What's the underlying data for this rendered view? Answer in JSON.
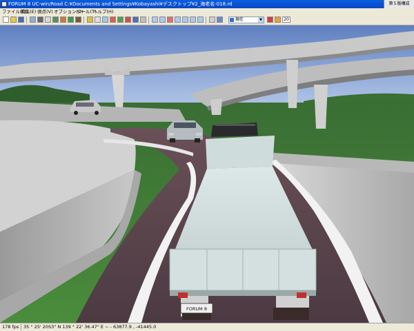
{
  "window": {
    "title": "FORUM 8   UC-win/Road   C:¥Documents and Settings¥Kobayashi¥デスクトップ¥2_海老名-018.rd",
    "right_label": "第５版構成"
  },
  "menu": [
    "ファイル(F)",
    "編集(E)",
    "視点(V)",
    "オプション(O)",
    "ツール(T)",
    "ヘルプ(H)"
  ],
  "toolbar": {
    "view_select_value": "現在",
    "zoom_label": "20"
  },
  "scene": {
    "truck_plate": "FORUM 8",
    "colors": {
      "sky_top": "#5f7fc0",
      "sky_bottom": "#b9cce8",
      "grass": "#3f7a36",
      "road": "#5a4650",
      "barrier": "#c9c9c9",
      "truck_body": "#e2ecea"
    }
  },
  "status": {
    "fps": "178 fps",
    "coords": "35 °  25' 20S3\" N 139 °  22' 36.47\" E   ~ - 63877.9 , -41445.0"
  }
}
